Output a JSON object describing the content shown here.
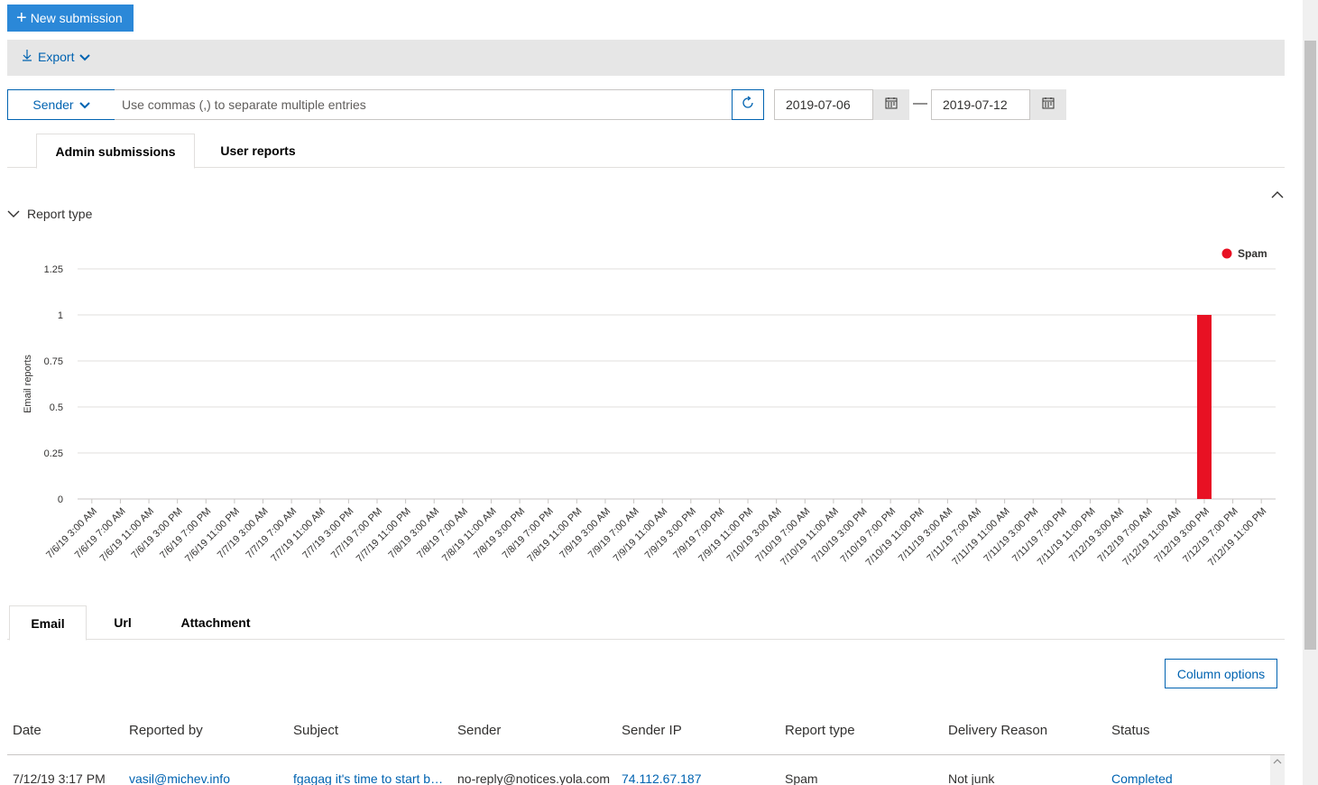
{
  "toolbar": {
    "new_submission": "New submission",
    "export": "Export"
  },
  "filter": {
    "sender_label": "Sender",
    "search_placeholder": "Use commas (,) to separate multiple entries",
    "date_from": "2019-07-06",
    "date_to": "2019-07-12",
    "date_separator": "—"
  },
  "top_tabs": [
    {
      "label": "Admin submissions",
      "active": true
    },
    {
      "label": "User reports",
      "active": false
    }
  ],
  "section": {
    "report_type_label": "Report type"
  },
  "chart_data": {
    "type": "bar",
    "ylabel": "Email reports",
    "xlabel": "",
    "ylim": [
      0,
      1.25
    ],
    "yticks": [
      "1.25",
      "1",
      "0.75",
      "0.5",
      "0.25",
      "0"
    ],
    "legend_position": "top-right",
    "categories": [
      "7/6/19 3:00 AM",
      "7/6/19 7:00 AM",
      "7/6/19 11:00 AM",
      "7/6/19 3:00 PM",
      "7/6/19 7:00 PM",
      "7/6/19 11:00 PM",
      "7/7/19 3:00 AM",
      "7/7/19 7:00 AM",
      "7/7/19 11:00 AM",
      "7/7/19 3:00 PM",
      "7/7/19 7:00 PM",
      "7/7/19 11:00 PM",
      "7/8/19 3:00 AM",
      "7/8/19 7:00 AM",
      "7/8/19 11:00 AM",
      "7/8/19 3:00 PM",
      "7/8/19 7:00 PM",
      "7/8/19 11:00 PM",
      "7/9/19 3:00 AM",
      "7/9/19 7:00 AM",
      "7/9/19 11:00 AM",
      "7/9/19 3:00 PM",
      "7/9/19 7:00 PM",
      "7/9/19 11:00 PM",
      "7/10/19 3:00 AM",
      "7/10/19 7:00 AM",
      "7/10/19 11:00 AM",
      "7/10/19 3:00 PM",
      "7/10/19 7:00 PM",
      "7/10/19 11:00 PM",
      "7/11/19 3:00 AM",
      "7/11/19 7:00 AM",
      "7/11/19 11:00 AM",
      "7/11/19 3:00 PM",
      "7/11/19 7:00 PM",
      "7/11/19 11:00 PM",
      "7/12/19 3:00 AM",
      "7/12/19 7:00 AM",
      "7/12/19 11:00 AM",
      "7/12/19 3:00 PM",
      "7/12/19 7:00 PM",
      "7/12/19 11:00 PM"
    ],
    "series": [
      {
        "name": "Spam",
        "color": "#e81123",
        "values": [
          0,
          0,
          0,
          0,
          0,
          0,
          0,
          0,
          0,
          0,
          0,
          0,
          0,
          0,
          0,
          0,
          0,
          0,
          0,
          0,
          0,
          0,
          0,
          0,
          0,
          0,
          0,
          0,
          0,
          0,
          0,
          0,
          0,
          0,
          0,
          0,
          0,
          0,
          0,
          1,
          0,
          0
        ]
      }
    ]
  },
  "bottom_tabs": [
    {
      "label": "Email",
      "active": true
    },
    {
      "label": "Url",
      "active": false
    },
    {
      "label": "Attachment",
      "active": false
    }
  ],
  "column_options": "Column options",
  "table": {
    "headers": [
      "Date",
      "Reported by",
      "Subject",
      "Sender",
      "Sender IP",
      "Report type",
      "Delivery Reason",
      "Status"
    ],
    "rows": [
      [
        "7/12/19 3:17 PM",
        "vasil@michev.info",
        "fgagag it's time to start b…",
        "no-reply@notices.yola.com",
        "74.112.67.187",
        "Spam",
        "Not junk",
        "Completed"
      ]
    ]
  }
}
